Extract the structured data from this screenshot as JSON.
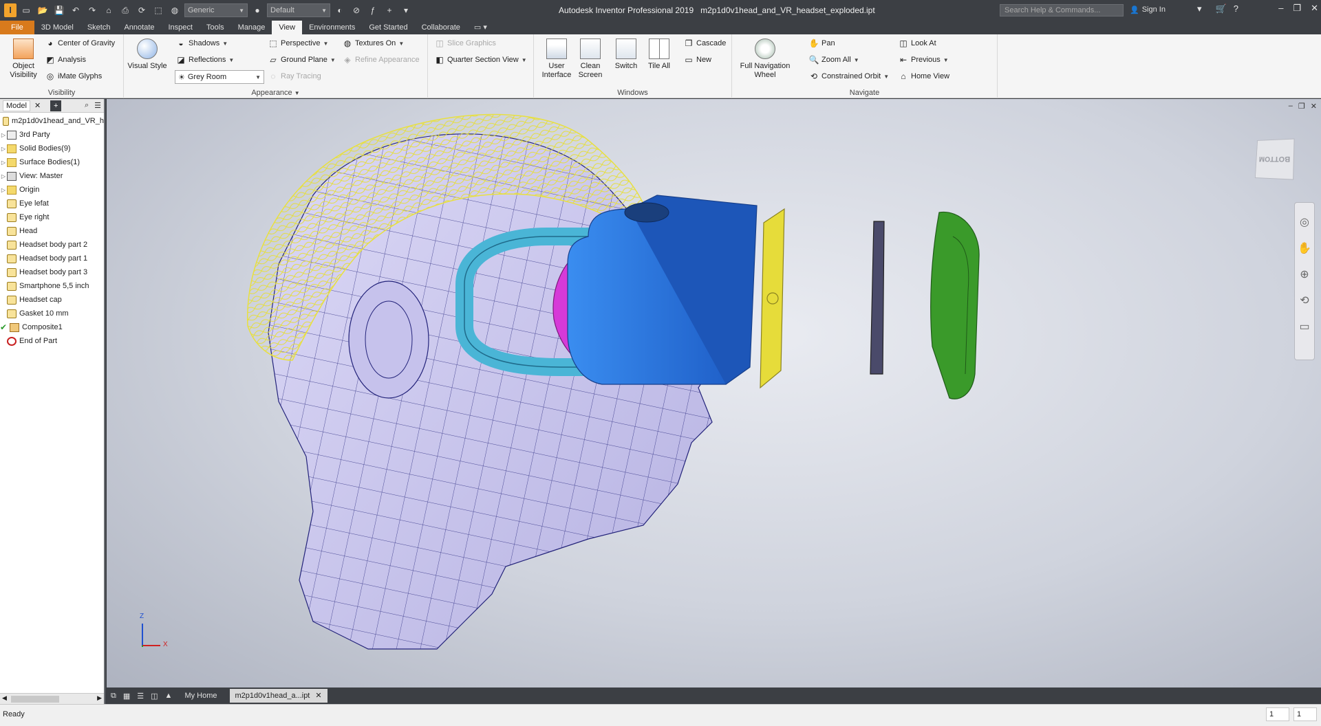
{
  "app": {
    "title": "Autodesk Inventor Professional 2019",
    "document": "m2p1d0v1head_and_VR_headset_exploded.ipt",
    "logo_text": "I"
  },
  "qat": {
    "material_combo": "Generic",
    "appearance_combo": "Default"
  },
  "search": {
    "placeholder": "Search Help & Commands..."
  },
  "account": {
    "signin": "Sign In"
  },
  "ribbon_tabs": [
    "File",
    "3D Model",
    "Sketch",
    "Annotate",
    "Inspect",
    "Tools",
    "Manage",
    "View",
    "Environments",
    "Get Started",
    "Collaborate"
  ],
  "active_tab": "View",
  "ribbon": {
    "visibility": {
      "title": "Visibility",
      "object_visibility": "Object Visibility",
      "center_of_gravity": "Center of Gravity",
      "analysis": "Analysis",
      "imate_glyphs": "iMate Glyphs"
    },
    "appearance": {
      "title": "Appearance",
      "visual_style": "Visual Style",
      "shadows": "Shadows",
      "reflections": "Reflections",
      "lighting_combo": "Grey Room",
      "perspective": "Perspective",
      "ground_plane": "Ground Plane",
      "ray_tracing": "Ray Tracing",
      "textures_on": "Textures On",
      "refine_appearance": "Refine Appearance",
      "slice_graphics": "Slice Graphics",
      "quarter_section_view": "Quarter Section View"
    },
    "windows": {
      "title": "Windows",
      "user_interface": "User Interface",
      "clean_screen": "Clean Screen",
      "switch": "Switch",
      "tile_all": "Tile All",
      "cascade": "Cascade",
      "new": "New"
    },
    "navigate": {
      "title": "Navigate",
      "full_navigation_wheel": "Full Navigation Wheel",
      "pan": "Pan",
      "zoom_all": "Zoom All",
      "constrained_orbit": "Constrained Orbit",
      "look_at": "Look At",
      "previous": "Previous",
      "home_view": "Home View"
    }
  },
  "browser": {
    "tab": "Model",
    "root": "m2p1d0v1head_and_VR_h",
    "items": [
      {
        "label": "3rd Party",
        "expandable": true
      },
      {
        "label": "Solid Bodies(9)",
        "expandable": true
      },
      {
        "label": "Surface Bodies(1)",
        "expandable": true
      },
      {
        "label": "View: Master",
        "expandable": true
      },
      {
        "label": "Origin",
        "expandable": true
      },
      {
        "label": "Eye lefat",
        "expandable": false
      },
      {
        "label": "Eye right",
        "expandable": false
      },
      {
        "label": "Head",
        "expandable": false
      },
      {
        "label": "Headset body part 2",
        "expandable": false
      },
      {
        "label": "Headset body part 1",
        "expandable": false
      },
      {
        "label": "Headset body part 3",
        "expandable": false
      },
      {
        "label": "Smartphone 5,5 inch",
        "expandable": false
      },
      {
        "label": "Headset cap",
        "expandable": false
      },
      {
        "label": "Gasket 10 mm",
        "expandable": false
      },
      {
        "label": "Composite1",
        "expandable": false
      },
      {
        "label": "End of Part",
        "expandable": false
      }
    ]
  },
  "viewport": {
    "viewcube_face": "BOTTOM",
    "axis_x": "X",
    "axis_z": "Z"
  },
  "doc_tabs": {
    "home": "My Home",
    "active": "m2p1d0v1head_a...ipt"
  },
  "status": {
    "text": "Ready",
    "count1": "1",
    "count2": "1"
  },
  "colors": {
    "title_bg": "#3c3f44",
    "file_tab": "#d87a1c",
    "headset_blue": "#2f7ee6",
    "gasket_cyan": "#4ab5d6",
    "strap_magenta": "#d63ad8",
    "phone_yellow": "#e6dc3a",
    "cap_green": "#3a9a2a",
    "hair_yellow": "#e8e040",
    "head_fill": "#c9c6ee"
  }
}
